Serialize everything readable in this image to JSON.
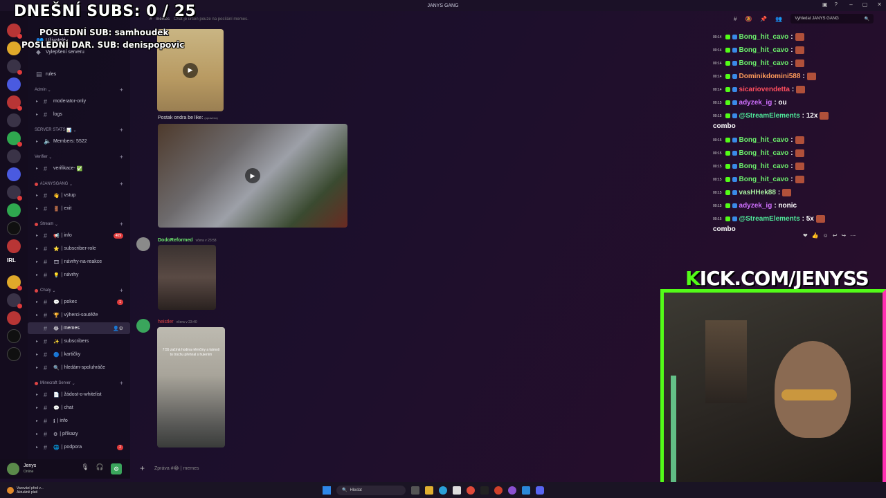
{
  "window": {
    "title": "JANYS GANG"
  },
  "colors": {
    "kick_green": "#53fc18",
    "accent_pink": "#ff2fb2",
    "online": "#3aa55c"
  },
  "overlay": {
    "subs": "DNEŠNÍ SUBS: 0 / 25",
    "last_sub": "POSLEDNÍ SUB: samhoudek",
    "last_donation": "POSLEDNÍ DAR. SUB: denispopovic",
    "kick_prefix": "K",
    "kick_rest": "ICK.COM/JENYSS"
  },
  "sidebar": {
    "top_items": [
      {
        "label": "Uživatelé"
      },
      {
        "label": "Vylepšení serveru"
      }
    ],
    "rules": "rules",
    "categories": {
      "admin": "Admin",
      "server_stats": "SERVER STATS",
      "verifier": "Verifier",
      "janys": "#JANYSGANG",
      "stream": "Stream",
      "chaty": "Chaty",
      "minecraft": "Minecraft Server"
    },
    "channels": {
      "moderator": "moderator-only",
      "logs": "logs",
      "members": "Members: 5522",
      "verifikace": "verifikace-",
      "vstup": "| vstup",
      "exit": "| exit",
      "info": "| info",
      "info_badge": "409",
      "subscriber_role": "| subscriber-role",
      "navrhy_reakce": "| návrhy-na-reakce",
      "navrhy": "| návrhy",
      "pokec": "| pokec",
      "pokec_badge": "1",
      "vyherci": "| výherci-soutěže",
      "memes": "| memes",
      "subscribers": "| subscribers",
      "karticky": "| kartičky",
      "hledam": "| hledám-spoluhráče",
      "zadost": "| žádost-o-whitelist",
      "chat": "| chat",
      "mc_info": "| info",
      "prikazy": "| příkazy",
      "podpora": "| podpora",
      "podpora_badge": "2"
    }
  },
  "user_panel": {
    "name": "Jenys",
    "status": "Online"
  },
  "topbar": {
    "channel": "memes",
    "topic": "Chat je určen pouze na posílání memes.",
    "search_placeholder": "Vyhledat JANYS GANG"
  },
  "messages": {
    "caption1": "Postak ondra be like:",
    "caption1_edited": "(upraveno)",
    "author2": "DodoReformed",
    "time2": "včera v 23:58",
    "author3": "heistler",
    "time3": "včera v 23:40",
    "video3_text": "7:55 začíná hodina němčiny a kámoš to trochu přehnal s hulením"
  },
  "composer": {
    "placeholder_prefix": "Zpráva #",
    "placeholder_channel": "| memes"
  },
  "chat": [
    {
      "ts": "00:14",
      "user": "Bong_hit_cavo",
      "color": "#6cf06c",
      "msg": ":",
      "emote": true
    },
    {
      "ts": "00:14",
      "user": "Bong_hit_cavo",
      "color": "#6cf06c",
      "msg": ":",
      "emote": true
    },
    {
      "ts": "00:14",
      "user": "Bong_hit_cavo",
      "color": "#6cf06c",
      "msg": ":",
      "emote": true
    },
    {
      "ts": "00:14",
      "user": "Dominikdomini588",
      "color": "#ff9a5a",
      "msg": ":",
      "emote": true
    },
    {
      "ts": "00:14",
      "user": "sicariovendetta",
      "color": "#ff4d5e",
      "msg": ":",
      "emote": true
    },
    {
      "ts": "00:15",
      "user": "adyzek_ig",
      "color": "#d070ff",
      "msg": ": ou",
      "emote": false
    },
    {
      "ts": "00:15",
      "user": "@StreamElements",
      "color": "#4fe89a",
      "msg": ": 12x",
      "emote": true,
      "cont": "combo"
    },
    {
      "ts": "00:15",
      "user": "Bong_hit_cavo",
      "color": "#6cf06c",
      "msg": ":",
      "emote": true
    },
    {
      "ts": "00:15",
      "user": "Bong_hit_cavo",
      "color": "#6cf06c",
      "msg": ":",
      "emote": true
    },
    {
      "ts": "00:15",
      "user": "Bong_hit_cavo",
      "color": "#6cf06c",
      "msg": ":",
      "emote": true
    },
    {
      "ts": "00:15",
      "user": "Bong_hit_cavo",
      "color": "#6cf06c",
      "msg": ":",
      "emote": true
    },
    {
      "ts": "00:15",
      "user": "vasHHek88",
      "color": "#a8f0a0",
      "msg": ":",
      "emote": true
    },
    {
      "ts": "00:15",
      "user": "adyzek_ig",
      "color": "#d070ff",
      "msg": ": nonic",
      "emote": false
    },
    {
      "ts": "00:15",
      "user": "@StreamElements",
      "color": "#4fe89a",
      "msg": ": 5x",
      "emote": true,
      "cont": "combo"
    }
  ],
  "taskbar": {
    "warning_title": "Varování před v...",
    "warning_sub": "Aktuálně platí",
    "search": "Hledat"
  }
}
